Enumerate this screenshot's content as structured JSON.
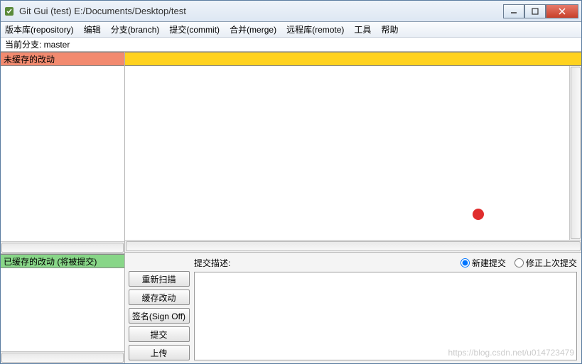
{
  "window": {
    "title": "Git Gui (test) E:/Documents/Desktop/test"
  },
  "menu": {
    "repository": "版本库(repository)",
    "edit": "编辑",
    "branch": "分支(branch)",
    "commit": "提交(commit)",
    "merge": "合并(merge)",
    "remote": "远程库(remote)",
    "tools": "工具",
    "help": "帮助"
  },
  "branch_bar": {
    "label": "当前分支: master"
  },
  "panes": {
    "unstaged_header": "未缓存的改动",
    "staged_header": "已缓存的改动 (将被提交)"
  },
  "commit": {
    "desc_label": "提交描述:",
    "radio_new": "新建提交",
    "radio_amend": "修正上次提交"
  },
  "buttons": {
    "rescan": "重新扫描",
    "stage": "缓存改动",
    "signoff": "签名(Sign Off)",
    "commit": "提交",
    "push": "上传"
  },
  "watermark": "https://blog.csdn.net/u014723479"
}
